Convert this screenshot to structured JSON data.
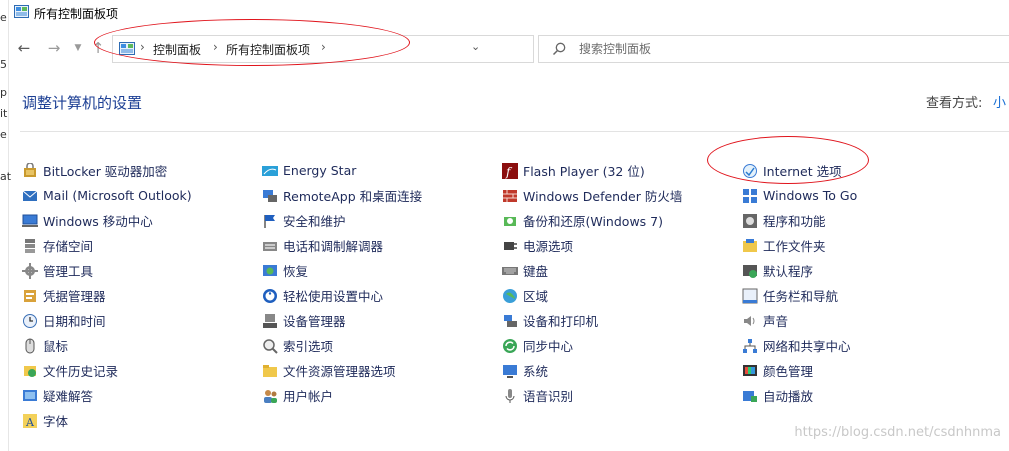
{
  "window": {
    "title": "所有控制面板项"
  },
  "nav": {
    "back_icon": "arrow-left-icon",
    "forward_icon": "arrow-right-icon",
    "recent_icon": "chevron-down-icon",
    "up_icon": "arrow-up-icon",
    "breadcrumb": [
      "控制面板",
      "所有控制面板项"
    ],
    "search_placeholder": "搜索控制面板"
  },
  "header": {
    "title": "调整计算机的设置",
    "view_label": "查看方式:",
    "view_value": "小"
  },
  "columns": [
    [
      {
        "label": "BitLocker 驱动器加密",
        "icon": "bitlocker-icon"
      },
      {
        "label": "Mail (Microsoft Outlook)",
        "icon": "mail-icon"
      },
      {
        "label": "Windows 移动中心",
        "icon": "mobility-center-icon"
      },
      {
        "label": "存储空间",
        "icon": "storage-spaces-icon"
      },
      {
        "label": "管理工具",
        "icon": "admin-tools-icon"
      },
      {
        "label": "凭据管理器",
        "icon": "credential-manager-icon"
      },
      {
        "label": "日期和时间",
        "icon": "date-time-icon"
      },
      {
        "label": "鼠标",
        "icon": "mouse-icon"
      },
      {
        "label": "文件历史记录",
        "icon": "file-history-icon"
      },
      {
        "label": "疑难解答",
        "icon": "troubleshooting-icon"
      },
      {
        "label": "字体",
        "icon": "fonts-icon"
      }
    ],
    [
      {
        "label": "Energy Star",
        "icon": "energy-star-icon"
      },
      {
        "label": "RemoteApp 和桌面连接",
        "icon": "remoteapp-icon"
      },
      {
        "label": "安全和维护",
        "icon": "security-flag-icon"
      },
      {
        "label": "电话和调制解调器",
        "icon": "phone-modem-icon"
      },
      {
        "label": "恢复",
        "icon": "recovery-icon"
      },
      {
        "label": "轻松使用设置中心",
        "icon": "ease-of-access-icon"
      },
      {
        "label": "设备管理器",
        "icon": "device-manager-icon"
      },
      {
        "label": "索引选项",
        "icon": "indexing-icon"
      },
      {
        "label": "文件资源管理器选项",
        "icon": "folder-options-icon"
      },
      {
        "label": "用户帐户",
        "icon": "user-accounts-icon"
      }
    ],
    [
      {
        "label": "Flash Player (32 位)",
        "icon": "flash-icon"
      },
      {
        "label": "Windows Defender 防火墙",
        "icon": "firewall-icon"
      },
      {
        "label": "备份和还原(Windows 7)",
        "icon": "backup-icon"
      },
      {
        "label": "电源选项",
        "icon": "power-options-icon"
      },
      {
        "label": "键盘",
        "icon": "keyboard-icon"
      },
      {
        "label": "区域",
        "icon": "region-icon"
      },
      {
        "label": "设备和打印机",
        "icon": "devices-printers-icon"
      },
      {
        "label": "同步中心",
        "icon": "sync-center-icon"
      },
      {
        "label": "系统",
        "icon": "system-icon"
      },
      {
        "label": "语音识别",
        "icon": "microphone-icon"
      }
    ],
    [
      {
        "label": "Internet 选项",
        "icon": "internet-options-icon"
      },
      {
        "label": "Windows To Go",
        "icon": "windows-to-go-icon"
      },
      {
        "label": "程序和功能",
        "icon": "programs-features-icon"
      },
      {
        "label": "工作文件夹",
        "icon": "work-folders-icon"
      },
      {
        "label": "默认程序",
        "icon": "default-programs-icon"
      },
      {
        "label": "任务栏和导航",
        "icon": "taskbar-icon"
      },
      {
        "label": "声音",
        "icon": "speaker-icon"
      },
      {
        "label": "网络和共享中心",
        "icon": "network-icon"
      },
      {
        "label": "颜色管理",
        "icon": "color-management-icon"
      },
      {
        "label": "自动播放",
        "icon": "autoplay-icon"
      }
    ]
  ],
  "left_strip_chars": [
    "e",
    "5",
    "p",
    "it",
    "e",
    "at"
  ],
  "watermark": "https://blog.csdn.net/csdnhnma",
  "colors": {
    "accent": "#1c3f94",
    "link": "#1a6fd4",
    "annotation": "#e0141c"
  }
}
